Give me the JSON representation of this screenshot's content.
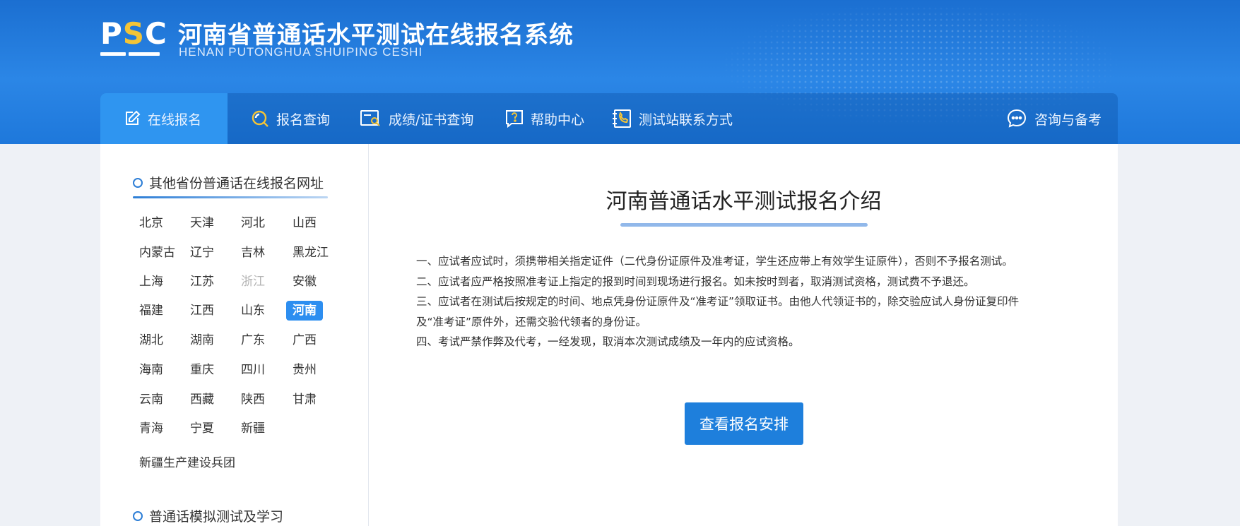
{
  "header": {
    "logo_text_p": "P",
    "logo_text_s": "S",
    "logo_text_c": "C",
    "title_cn": "河南省普通话水平测试在线报名系统",
    "title_en": "HENAN PUTONGHUA SHUIPING CESHI",
    "colors": {
      "primary": "#1e78db",
      "logo_accent": "#f4c436"
    }
  },
  "nav": {
    "items": [
      {
        "label": "在线报名",
        "icon": "edit-icon",
        "active": true
      },
      {
        "label": "报名查询",
        "icon": "search-icon",
        "active": false
      },
      {
        "label": "成绩/证书查询",
        "icon": "certificate-search-icon",
        "active": false
      },
      {
        "label": "帮助中心",
        "icon": "help-icon",
        "active": false
      },
      {
        "label": "测试站联系方式",
        "icon": "phone-book-icon",
        "active": false
      }
    ],
    "consult": {
      "label": "咨询与备考",
      "icon": "chat-icon"
    }
  },
  "sidebar": {
    "heading": "其他省份普通话在线报名网址",
    "provinces": [
      {
        "name": "北京",
        "state": "normal"
      },
      {
        "name": "天津",
        "state": "normal"
      },
      {
        "name": "河北",
        "state": "normal"
      },
      {
        "name": "山西",
        "state": "normal"
      },
      {
        "name": "内蒙古",
        "state": "normal"
      },
      {
        "name": "辽宁",
        "state": "normal"
      },
      {
        "name": "吉林",
        "state": "normal"
      },
      {
        "name": "黑龙江",
        "state": "normal"
      },
      {
        "name": "上海",
        "state": "normal"
      },
      {
        "name": "江苏",
        "state": "normal"
      },
      {
        "name": "浙江",
        "state": "disabled"
      },
      {
        "name": "安徽",
        "state": "normal"
      },
      {
        "name": "福建",
        "state": "normal"
      },
      {
        "name": "江西",
        "state": "normal"
      },
      {
        "name": "山东",
        "state": "normal"
      },
      {
        "name": "河南",
        "state": "active"
      },
      {
        "name": "湖北",
        "state": "normal"
      },
      {
        "name": "湖南",
        "state": "normal"
      },
      {
        "name": "广东",
        "state": "normal"
      },
      {
        "name": "广西",
        "state": "normal"
      },
      {
        "name": "海南",
        "state": "normal"
      },
      {
        "name": "重庆",
        "state": "normal"
      },
      {
        "name": "四川",
        "state": "normal"
      },
      {
        "name": "贵州",
        "state": "normal"
      },
      {
        "name": "云南",
        "state": "normal"
      },
      {
        "name": "西藏",
        "state": "normal"
      },
      {
        "name": "陕西",
        "state": "normal"
      },
      {
        "name": "甘肃",
        "state": "normal"
      },
      {
        "name": "青海",
        "state": "normal"
      },
      {
        "name": "宁夏",
        "state": "normal"
      },
      {
        "name": "新疆",
        "state": "normal"
      }
    ],
    "extra_link": "新疆生产建设兵团",
    "section2_heading": "普通话模拟测试及学习"
  },
  "main": {
    "title": "河南普通话水平测试报名介绍",
    "paragraphs": [
      "一、应试者应试时，须携带相关指定证件（二代身份证原件及准考证，学生还应带上有效学生证原件），否则不予报名测试。",
      "二、应试者应严格按照准考证上指定的报到时间到现场进行报名。如未按时到者，取消测试资格，测试费不予退还。",
      "三、应试者在测试后按规定的时间、地点凭身份证原件及“准考证”领取证书。由他人代领证书的，除交验应试人身份证复印件",
      "及“准考证”原件外，还需交验代领者的身份证。",
      "四、考试严禁作弊及代考，一经发现，取消本次测试成绩及一年内的应试资格。"
    ],
    "cta_label": "查看报名安排"
  }
}
